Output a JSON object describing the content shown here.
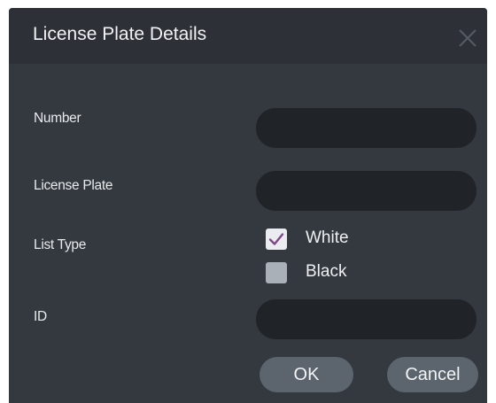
{
  "dialog": {
    "title": "License Plate Details",
    "close_icon": "close-icon"
  },
  "form": {
    "number_label": "Number",
    "number_value": "",
    "license_plate_label": "License Plate",
    "license_plate_value": "",
    "list_type_label": "List Type",
    "list_type_options": [
      {
        "label": "White",
        "checked": true
      },
      {
        "label": "Black",
        "checked": false
      }
    ],
    "id_label": "ID",
    "id_value": ""
  },
  "buttons": {
    "ok_label": "OK",
    "cancel_label": "Cancel"
  },
  "colors": {
    "dialog_bg": "#343940",
    "titlebar_bg": "#2d3137",
    "field_bg": "#202328",
    "button_bg": "#5c646d",
    "checkmark": "#7b4a86"
  }
}
